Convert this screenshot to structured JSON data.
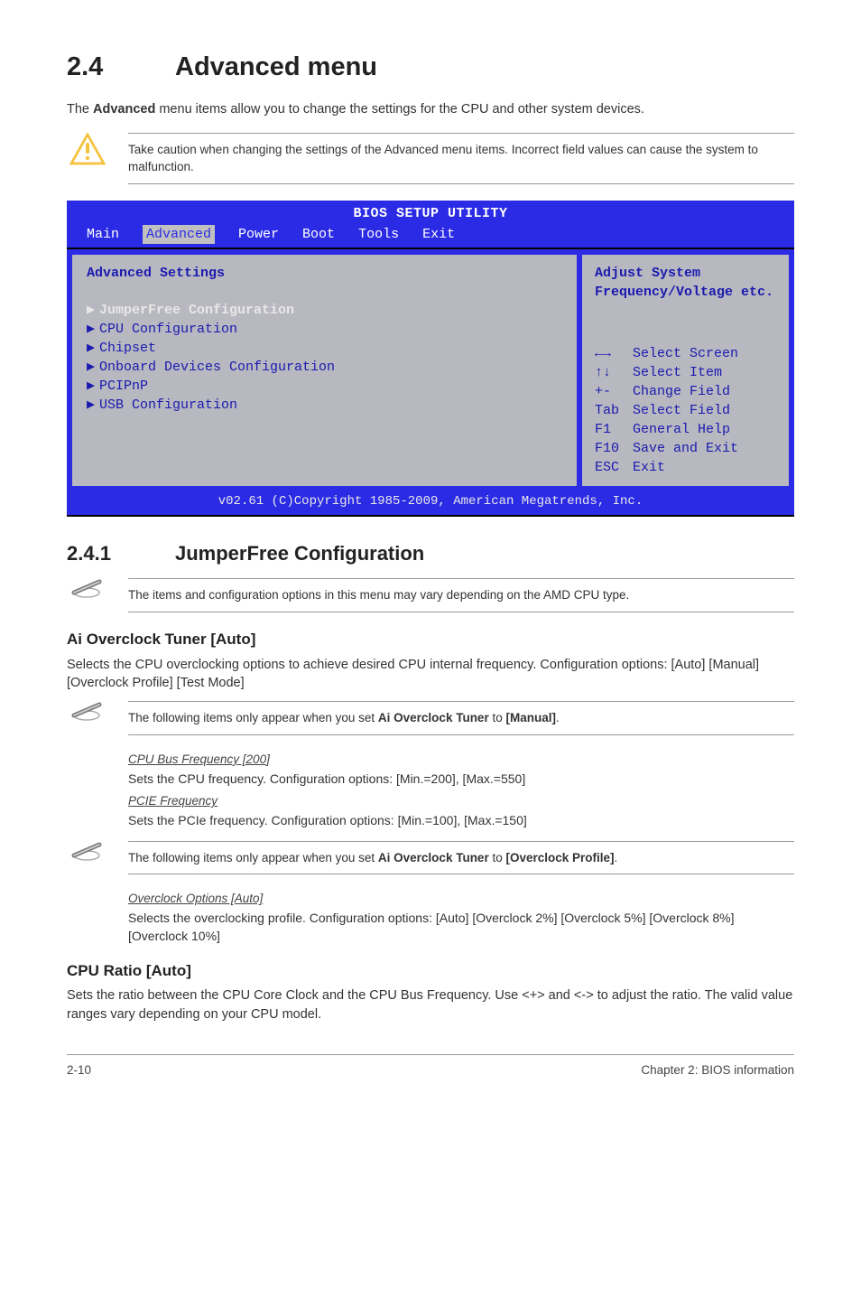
{
  "section": {
    "number": "2.4",
    "title": "Advanced menu",
    "intro_pre": "The ",
    "intro_bold": "Advanced",
    "intro_post": " menu items allow you to change the settings for the CPU and other system devices."
  },
  "caution": {
    "text": "Take caution when changing the settings of the Advanced menu items. Incorrect field values can cause the system to malfunction."
  },
  "bios": {
    "title": "BIOS SETUP UTILITY",
    "tabs": [
      "Main",
      "Advanced",
      "Power",
      "Boot",
      "Tools",
      "Exit"
    ],
    "selected_tab": 1,
    "left_heading": "Advanced Settings",
    "items": [
      "JumperFree Configuration",
      "CPU Configuration",
      "Chipset",
      "Onboard Devices Configuration",
      "PCIPnP",
      "USB Configuration"
    ],
    "selected_item": 0,
    "right_top": [
      "Adjust System",
      "Frequency/Voltage etc."
    ],
    "help": [
      {
        "key": "←→",
        "action": "Select Screen"
      },
      {
        "key": "↑↓",
        "action": "Select Item"
      },
      {
        "key": "+-",
        "action": "Change Field"
      },
      {
        "key": "Tab",
        "action": "Select Field"
      },
      {
        "key": "F1",
        "action": "General Help"
      },
      {
        "key": "F10",
        "action": "Save and Exit"
      },
      {
        "key": "ESC",
        "action": "Exit"
      }
    ],
    "footer": "v02.61 (C)Copyright 1985-2009, American Megatrends, Inc."
  },
  "subsection": {
    "number": "2.4.1",
    "title": "JumperFree Configuration"
  },
  "note_jumperfree": {
    "text": "The items and configuration options in this menu may vary depending on the AMD CPU type."
  },
  "ai_tuner": {
    "heading": "Ai Overclock Tuner [Auto]",
    "body": "Selects the CPU overclocking options to achieve desired CPU internal frequency. Configuration options: [Auto] [Manual] [Overclock Profile] [Test Mode]"
  },
  "note_manual": {
    "pre": "The following items only appear when you set ",
    "bold1": "Ai Overclock Tuner",
    "mid": " to ",
    "bold2": "[Manual]",
    "post": "."
  },
  "cpu_bus": {
    "heading": "CPU Bus Frequency [200]",
    "body": "Sets the CPU frequency. Configuration options: [Min.=200], [Max.=550]"
  },
  "pcie": {
    "heading": "PCIE Frequency",
    "body": "Sets the PCIe frequency. Configuration options: [Min.=100], [Max.=150]"
  },
  "note_profile": {
    "pre": "The following items only appear when you set ",
    "bold1": "Ai Overclock Tuner",
    "mid": " to ",
    "bold2": "[Overclock Profile]",
    "post": "."
  },
  "overclock_opts": {
    "heading": "Overclock Options [Auto]",
    "body": "Selects the overclocking profile. Configuration options: [Auto] [Overclock 2%] [Overclock 5%] [Overclock 8%] [Overclock 10%]"
  },
  "cpu_ratio": {
    "heading": "CPU Ratio [Auto]",
    "body": "Sets the ratio between the CPU Core Clock and the CPU Bus Frequency. Use <+> and <-> to adjust the ratio. The valid value ranges vary depending on your CPU model."
  },
  "footer": {
    "left": "2-10",
    "right": "Chapter 2: BIOS information"
  }
}
